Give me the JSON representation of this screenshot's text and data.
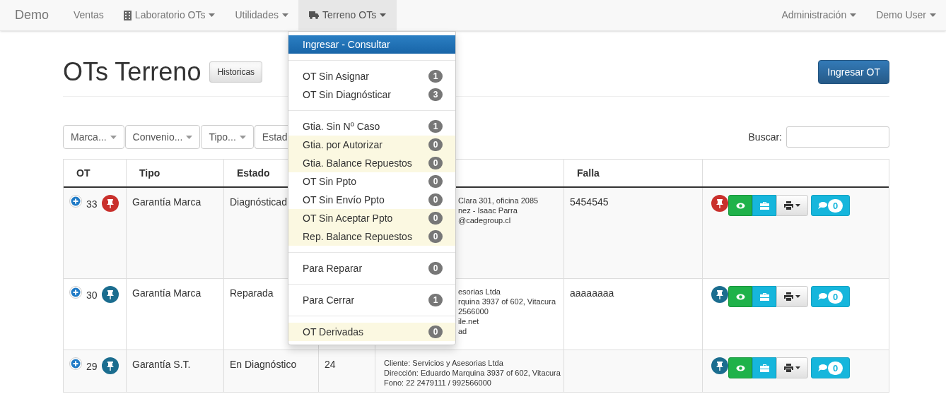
{
  "navbar": {
    "brand": "Demo",
    "left": [
      {
        "label": "Ventas",
        "caret": false,
        "active": false
      },
      {
        "label": "Laboratorio OTs",
        "caret": true,
        "active": false
      },
      {
        "label": "Utilidades",
        "caret": true,
        "active": false
      },
      {
        "label": "Terreno OTs",
        "caret": true,
        "active": true
      }
    ],
    "right": [
      {
        "label": "Administración",
        "caret": true
      },
      {
        "label": "Demo User",
        "caret": true
      }
    ]
  },
  "page": {
    "title": "OTs Terreno",
    "historicas_button": "Historicas",
    "new_button": "Ingresar OT"
  },
  "filters": [
    {
      "label": "Marca...",
      "caret": true
    },
    {
      "label": "Convenio...",
      "caret": true
    },
    {
      "label": "Tipo...",
      "caret": true
    },
    {
      "label": "Estad",
      "caret": false
    }
  ],
  "search": {
    "label": "Buscar:"
  },
  "table": {
    "columns": [
      {
        "kind": "label",
        "label": "OT"
      },
      {
        "kind": "label",
        "label": "Tipo"
      },
      {
        "kind": "label",
        "label": "Estado"
      },
      {
        "kind": "blank"
      },
      {
        "kind": "blank"
      },
      {
        "kind": "label",
        "label": "Falla"
      },
      {
        "kind": "blank"
      }
    ],
    "rows": [
      {
        "ot": "33",
        "color": "#c9302c",
        "tipo": "Garantía Marca",
        "estado": "Diagnósticad",
        "detail_cut": true,
        "detail": [
          "Clara 301, oficina 2085",
          "nez - Isaac Parra",
          "@cadegroup.cl"
        ],
        "falla": "5454545",
        "comments": "0"
      },
      {
        "ot": "30",
        "color": "#1b6d8f",
        "tipo": "Garantía Marca",
        "estado": "Reparada",
        "detail_cut": true,
        "detail": [
          "esorias Ltda",
          "rquina 3937 of 602, Vitacura",
          "2566000",
          "ile.net",
          "ad"
        ],
        "falla": "aaaaaaaa",
        "comments": "0"
      },
      {
        "ot": "29",
        "color": "#1b6d8f",
        "tipo": "Garantía S.T.",
        "estado": "En Diagnóstico",
        "column_4": "24",
        "detail_cut": false,
        "detail": [
          "Cliente: Servicios y Asesorias Ltda",
          "Dirección: Eduardo Marquina 3937 of 602, Vitacura",
          "Fono: 22 2479111 / 992566000"
        ],
        "comments": "0"
      }
    ]
  },
  "dropdown": [
    {
      "kind": "item",
      "label": "Ingresar - Consultar",
      "selected": true
    },
    {
      "kind": "divider"
    },
    {
      "kind": "item",
      "label": "OT Sin Asignar",
      "badge": "1",
      "selected": false,
      "highlighted": false
    },
    {
      "kind": "item",
      "label": "OT Sin Diagnósticar",
      "badge": "3",
      "selected": false,
      "highlighted": false
    },
    {
      "kind": "divider"
    },
    {
      "kind": "item",
      "label": "Gtia. Sin Nº Caso",
      "badge": "1",
      "selected": false,
      "highlighted": false
    },
    {
      "kind": "item",
      "label": "Gtia. por Autorizar",
      "badge": "0",
      "selected": false,
      "highlighted": true
    },
    {
      "kind": "item",
      "label": "Gtia. Balance Repuestos",
      "badge": "0",
      "selected": false,
      "highlighted": true
    },
    {
      "kind": "item",
      "label": "OT Sin Ppto",
      "badge": "0",
      "selected": false,
      "highlighted": false
    },
    {
      "kind": "item",
      "label": "OT Sin Envío Ppto",
      "badge": "0",
      "selected": false,
      "highlighted": false
    },
    {
      "kind": "item",
      "label": "OT Sin Aceptar Ppto",
      "badge": "0",
      "selected": false,
      "highlighted": true
    },
    {
      "kind": "item",
      "label": "Rep. Balance Repuestos",
      "badge": "0",
      "selected": false,
      "highlighted": true
    },
    {
      "kind": "divider"
    },
    {
      "kind": "item",
      "label": "Para Reparar",
      "badge": "0",
      "selected": false,
      "highlighted": false
    },
    {
      "kind": "divider"
    },
    {
      "kind": "item",
      "label": "Para Cerrar",
      "badge": "1",
      "selected": false,
      "highlighted": false
    },
    {
      "kind": "divider"
    },
    {
      "kind": "item",
      "label": "OT Derivadas",
      "badge": "0",
      "selected": false,
      "highlighted": true
    }
  ]
}
